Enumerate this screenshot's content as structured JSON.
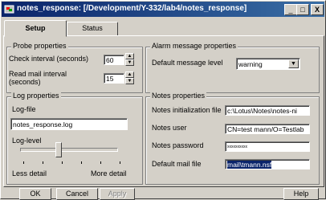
{
  "window": {
    "title": "notes_response: [/Development/Y-332/lab4/notes_response]",
    "minimize": "_",
    "maximize": "□",
    "close": "X"
  },
  "tabs": [
    {
      "label": "Setup",
      "selected": true
    },
    {
      "label": "Status",
      "selected": false
    }
  ],
  "probe": {
    "title": "Probe properties",
    "check_interval_label": "Check interval (seconds)",
    "check_interval_value": "60",
    "read_mail_label_1": "Read mail interval",
    "read_mail_label_2": "(seconds)",
    "read_mail_value": "15"
  },
  "alarm": {
    "title": "Alarm message properties",
    "default_level_label": "Default message level",
    "default_level_value": "warning"
  },
  "log": {
    "title": "Log properties",
    "logfile_label": "Log-file",
    "logfile_value": "notes_response.log",
    "loglevel_label": "Log-level",
    "less_detail": "Less detail",
    "more_detail": "More detail",
    "level_fraction": 0.4
  },
  "notes": {
    "title": "Notes properties",
    "init_file_label": "Notes initialization file",
    "init_file_value": "c:\\Lotus\\Notes\\notes-ni",
    "user_label": "Notes user",
    "user_value": "CN=test mann/O=Testlab",
    "password_label": "Notes password",
    "password_value": "xxxxxxxxxx",
    "mail_file_label": "Default mail file",
    "mail_file_value": "mail\\tmann.nsf"
  },
  "buttons": {
    "ok": "OK",
    "cancel": "Cancel",
    "apply": "Apply",
    "help": "Help"
  },
  "colors": {
    "title_bar": "#0a246a",
    "face": "#d4d0c8",
    "selection": "#0a246a"
  }
}
